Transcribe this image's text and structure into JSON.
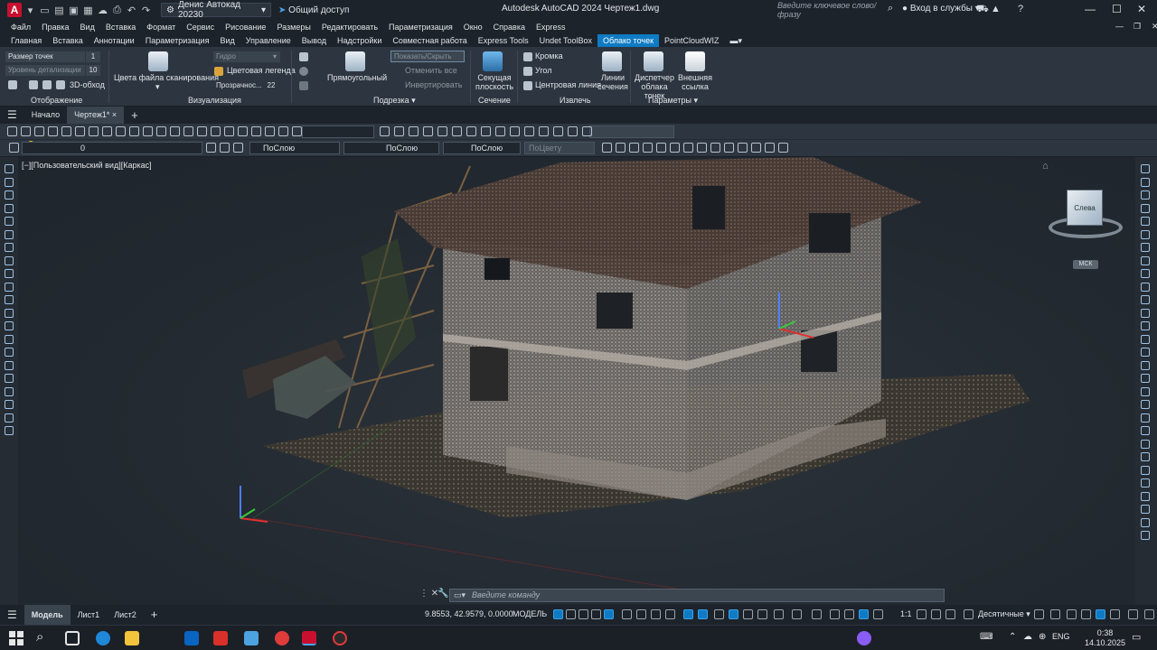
{
  "colors": {
    "accent": "#0f7bc4",
    "autocad_red": "#c8102e",
    "background": "#212830"
  },
  "titlebar": {
    "account": "Денис Автокад 20230",
    "share": "Общий доступ",
    "title": "Autodesk AutoCAD 2024   Чертеж1.dwg",
    "search_placeholder": "Введите ключевое слово/фразу",
    "signin": "Вход в службы"
  },
  "menu": [
    "Файл",
    "Правка",
    "Вид",
    "Вставка",
    "Формат",
    "Сервис",
    "Рисование",
    "Размеры",
    "Редактировать",
    "Параметризация",
    "Окно",
    "Справка",
    "Express"
  ],
  "tabs": [
    {
      "label": "Главная"
    },
    {
      "label": "Вставка"
    },
    {
      "label": "Аннотации"
    },
    {
      "label": "Параметризация"
    },
    {
      "label": "Вид"
    },
    {
      "label": "Управление"
    },
    {
      "label": "Вывод"
    },
    {
      "label": "Надстройки"
    },
    {
      "label": "Совместная работа"
    },
    {
      "label": "Express Tools"
    },
    {
      "label": "Undet ToolBox"
    },
    {
      "label": "Облако точек",
      "active": true
    },
    {
      "label": "PointCloudWIZ"
    }
  ],
  "ribbon": {
    "display": {
      "point_size_label": "Размер точек",
      "point_size_value": "1",
      "lod_label": "Уровень детализации",
      "lod_value": "10",
      "orbit_label": "3D-обход",
      "title": "Отображение"
    },
    "visualization": {
      "scan_colors": "Цвета файла сканирования",
      "color_mode": "Гидро",
      "color_legend": "Цветовая легенда",
      "transparency_label": "Прозрачнос...",
      "transparency_value": "22",
      "title": "Визуализация"
    },
    "cropping": {
      "rect": "Прямоугольный",
      "show_hide": "Показать/Скрыть",
      "undo_all": "Отменить все",
      "invert": "Инвертировать",
      "title": "Подрезка"
    },
    "section": {
      "plane": "Секущая плоскость",
      "title": "Сечение"
    },
    "extract": {
      "edge": "Кромка",
      "corner": "Угол",
      "centerline": "Центровая линия",
      "section_lines": "Линии сечения",
      "title": "Извлечь"
    },
    "options": {
      "manager": "Диспетчер облака точек",
      "external": "Внешняя ссылка",
      "title": "Параметры"
    }
  },
  "doc_tabs": {
    "start": "Начало",
    "drawing": "Чертеж1*"
  },
  "toolbar2": {
    "layer": "0",
    "color": "ПоСлою",
    "linetype": "ПоСлою",
    "lineweight": "ПоСлою",
    "plotstyle": "ПоЦвету"
  },
  "viewport": {
    "label": "[−][Пользовательский вид][Каркас]",
    "viewcube_face": "Слева",
    "ucs_label": "МСК"
  },
  "cmdline": {
    "placeholder": "Введите команду"
  },
  "status": {
    "layouts": [
      {
        "label": "Модель",
        "active": true
      },
      {
        "label": "Лист1"
      },
      {
        "label": "Лист2"
      }
    ],
    "coords": "9.8553, 42.9579, 0.0000",
    "model": "МОДЕЛЬ",
    "scale": "1:1",
    "units": "Десятичные"
  },
  "taskbar": {
    "lang": "ENG",
    "time": "0:38",
    "date": "14.10.2025"
  }
}
